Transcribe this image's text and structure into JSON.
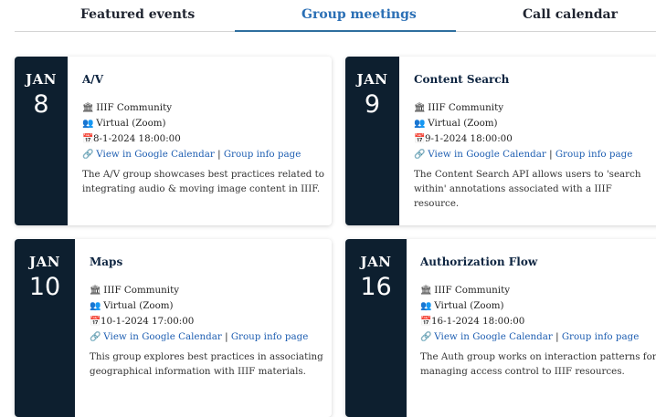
{
  "tabs": {
    "featured": "Featured events",
    "group": "Group meetings",
    "call": "Call calendar"
  },
  "icons": {
    "community": "landmark-icon",
    "location": "people-group-icon",
    "date": "calendar-icon",
    "link": "link-icon"
  },
  "colors": {
    "date_block": "#0d1f2f",
    "active_tab": "#2a6fb5",
    "link": "#1f5fb2"
  },
  "events": [
    {
      "month": "JAN",
      "day": "8",
      "title": "A/V",
      "community": "IIIF Community",
      "location": "Virtual (Zoom)",
      "datetime": "8-1-2024 18:00:00",
      "calendar_link": "View in Google Calendar",
      "separator": "|",
      "group_link": "Group info page",
      "description": "The A/V group showcases best practices related to integrating audio & moving image content in IIIF."
    },
    {
      "month": "JAN",
      "day": "9",
      "title": "Content Search",
      "community": "IIIF Community",
      "location": "Virtual (Zoom)",
      "datetime": "9-1-2024 18:00:00",
      "calendar_link": "View in Google Calendar",
      "separator": "|",
      "group_link": "Group info page",
      "description": "The Content Search API allows users to 'search within' annotations associated with a IIIF resource."
    },
    {
      "month": "JAN",
      "day": "10",
      "title": "Maps",
      "community": "IIIF Community",
      "location": "Virtual (Zoom)",
      "datetime": "10-1-2024 17:00:00",
      "calendar_link": "View in Google Calendar",
      "separator": "|",
      "group_link": "Group info page",
      "description": "This group explores best practices in associating geographical information with IIIF materials."
    },
    {
      "month": "JAN",
      "day": "16",
      "title": "Authorization Flow",
      "community": "IIIF Community",
      "location": "Virtual (Zoom)",
      "datetime": "16-1-2024 18:00:00",
      "calendar_link": "View in Google Calendar",
      "separator": "|",
      "group_link": "Group info page",
      "description": "The Auth group works on interaction patterns for managing access control to IIIF resources."
    }
  ]
}
